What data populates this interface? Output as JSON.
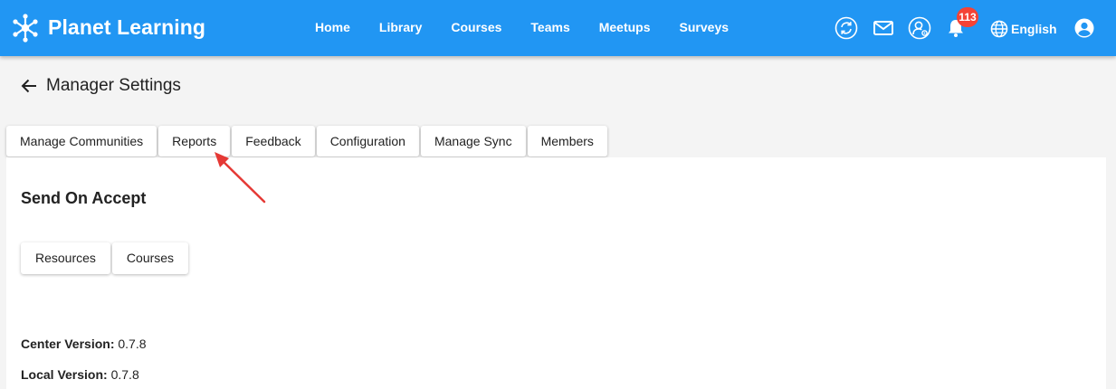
{
  "app": {
    "brand": "Planet Learning"
  },
  "nav": [
    {
      "label": "Home"
    },
    {
      "label": "Library"
    },
    {
      "label": "Courses"
    },
    {
      "label": "Teams"
    },
    {
      "label": "Meetups"
    },
    {
      "label": "Surveys"
    }
  ],
  "toolbar": {
    "notification_count": "113",
    "language": "English",
    "icons": [
      "sync-icon",
      "mail-icon",
      "manager-icon",
      "bell-icon",
      "globe-icon",
      "account-icon"
    ]
  },
  "page": {
    "title": "Manager Settings"
  },
  "tabs": [
    {
      "label": "Manage Communities"
    },
    {
      "label": "Reports"
    },
    {
      "label": "Feedback"
    },
    {
      "label": "Configuration"
    },
    {
      "label": "Manage Sync"
    },
    {
      "label": "Members"
    }
  ],
  "send_on_accept": {
    "title": "Send On Accept",
    "buttons": [
      {
        "label": "Resources"
      },
      {
        "label": "Courses"
      }
    ]
  },
  "versions": {
    "center_label": "Center Version:",
    "center_value": "0.7.8",
    "local_label": "Local Version:",
    "local_value": "0.7.8"
  },
  "colors": {
    "toolbar": "#2196f3",
    "badge": "#f44336",
    "annotation_arrow": "#e53935",
    "background": "#f4f4f4"
  }
}
